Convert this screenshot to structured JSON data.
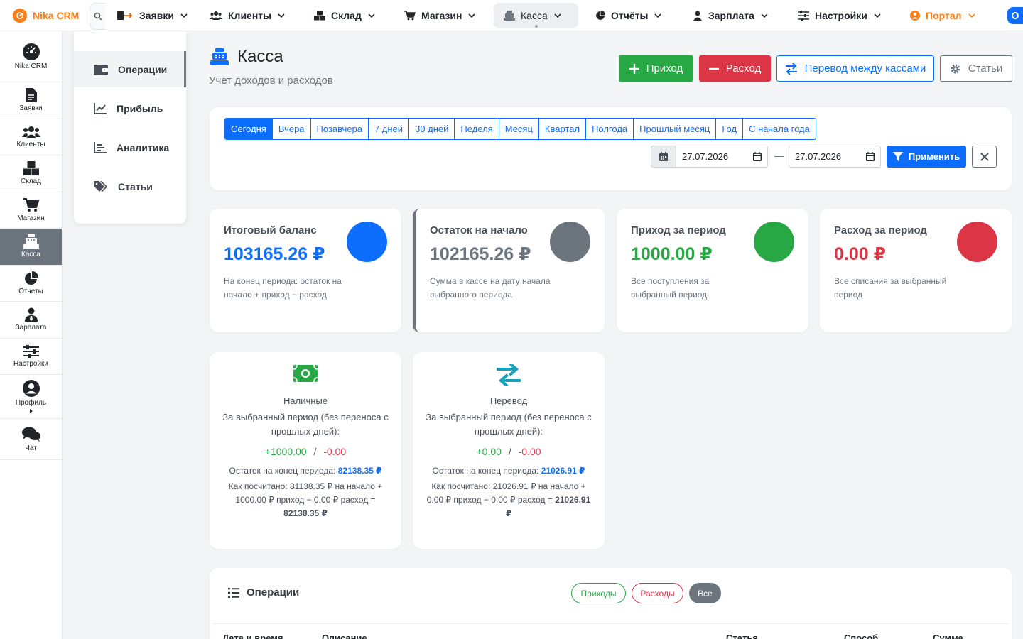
{
  "app": {
    "brand": "Nika CRM"
  },
  "topnav": {
    "items": [
      {
        "label": "Заявки"
      },
      {
        "label": "Клиенты"
      },
      {
        "label": "Склад"
      },
      {
        "label": "Магазин"
      },
      {
        "label": "Касса"
      },
      {
        "label": "Отчёты"
      },
      {
        "label": "Зарплата"
      },
      {
        "label": "Настройки"
      },
      {
        "label": "Портал"
      }
    ]
  },
  "rail": {
    "items": [
      {
        "label": "Nika CRM",
        "icon": "dashboard-icon"
      },
      {
        "label": "Заявки",
        "icon": "document-icon"
      },
      {
        "label": "Клиенты",
        "icon": "users-icon"
      },
      {
        "label": "Склад",
        "icon": "boxes-icon"
      },
      {
        "label": "Магазин",
        "icon": "cart-icon"
      },
      {
        "label": "Касса",
        "icon": "cash-register-icon"
      },
      {
        "label": "Отчеты",
        "icon": "pie-chart-icon"
      },
      {
        "label": "Зарплата",
        "icon": "user-tie-icon"
      },
      {
        "label": "Настройки",
        "icon": "sliders-icon"
      },
      {
        "label": "Профиль",
        "icon": "user-circle-icon"
      },
      {
        "label": "Чат",
        "icon": "chat-icon"
      }
    ]
  },
  "submenu": {
    "items": [
      {
        "label": "Операции",
        "icon": "wallet-icon"
      },
      {
        "label": "Прибыль",
        "icon": "line-chart-icon"
      },
      {
        "label": "Аналитика",
        "icon": "bar-chart-icon"
      },
      {
        "label": "Статьи",
        "icon": "tags-icon"
      }
    ]
  },
  "header": {
    "title": "Касса",
    "subtitle": "Учет доходов и расходов",
    "buttons": {
      "income": "Приход",
      "expense": "Расход",
      "transfer": "Перевод между кассами",
      "articles": "Статьи"
    }
  },
  "filter": {
    "periods": [
      "Сегодня",
      "Вчера",
      "Позавчера",
      "7 дней",
      "30 дней",
      "Неделя",
      "Месяц",
      "Квартал",
      "Полгода",
      "Прошлый месяц",
      "Год",
      "С начала года"
    ],
    "active_period": "Сегодня",
    "date_from": "27.07.2026",
    "date_to": "27.07.2026",
    "separator": "—",
    "apply": "Применить"
  },
  "stats": [
    {
      "label": "Итоговый баланс",
      "value": "103165.26 ₽",
      "desc": "На конец периода: остаток на начало + приход − расход",
      "color": "#0d6efd"
    },
    {
      "label": "Остаток на начало",
      "value": "102165.26 ₽",
      "desc": "Сумма в кассе на дату начала выбранного периода",
      "color": "#6c757d"
    },
    {
      "label": "Приход за период",
      "value": "1000.00 ₽",
      "desc": "Все поступления за выбранный период",
      "color": "#28a745"
    },
    {
      "label": "Расход за период",
      "value": "0.00 ₽",
      "desc": "Все списания за выбранный период",
      "color": "#dc3545"
    }
  ],
  "methods": [
    {
      "name": "Наличные",
      "desc": "За выбранный период (без переноса с прошлых дней):",
      "plus": "+1000.00",
      "slash": "/",
      "minus": "-0.00",
      "remainder_label": "Остаток на конец периода:",
      "remainder_value": "82138.35 ₽",
      "calc_text": "Как посчитано: 81138.35 ₽ на начало + 1000.00 ₽ приход − 0.00 ₽ расход =",
      "calc_result": "82138.35 ₽"
    },
    {
      "name": "Перевод",
      "desc": "За выбранный период (без переноса с прошлых дней):",
      "plus": "+0.00",
      "slash": "/",
      "minus": "-0.00",
      "remainder_label": "Остаток на конец периода:",
      "remainder_value": "21026.91 ₽",
      "calc_text": "Как посчитано: 21026.91 ₽ на начало + 0.00 ₽ приход − 0.00 ₽ расход =",
      "calc_result": "21026.91 ₽"
    }
  ],
  "operations": {
    "title": "Операции",
    "filters": {
      "income": "Приходы",
      "expense": "Расходы",
      "all": "Все"
    },
    "columns": [
      "Дата и время",
      "Описание",
      "Статья",
      "Способ",
      "Сумма"
    ]
  }
}
